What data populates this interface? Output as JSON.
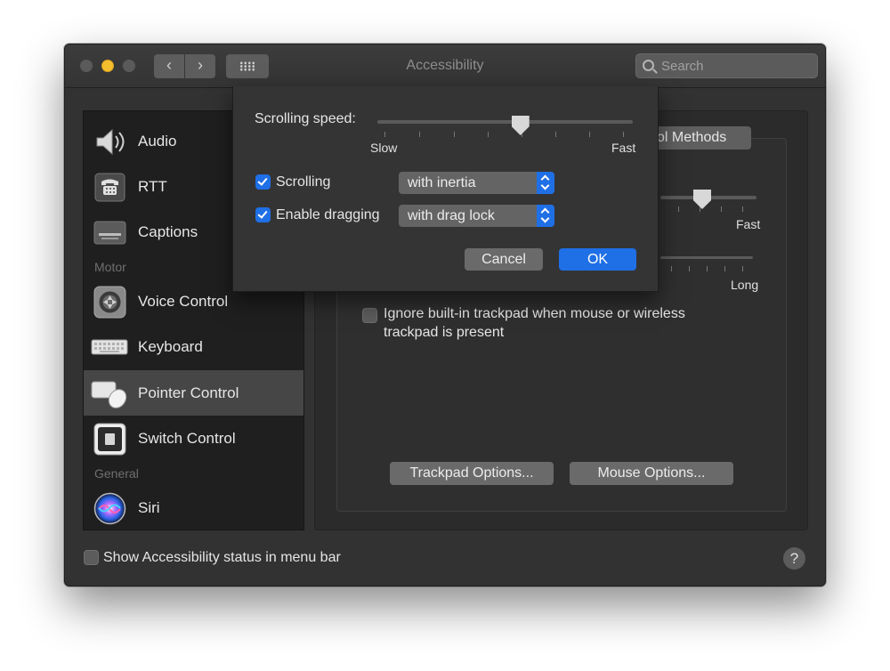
{
  "window": {
    "title": "Accessibility"
  },
  "search": {
    "placeholder": "Search"
  },
  "sidebar": {
    "items": [
      {
        "label": "Audio",
        "icon": "speaker-icon"
      },
      {
        "label": "RTT",
        "icon": "telephone-icon"
      },
      {
        "label": "Captions",
        "icon": "captions-icon"
      },
      {
        "label": "Voice Control",
        "icon": "voice-control-icon"
      },
      {
        "label": "Keyboard",
        "icon": "keyboard-icon"
      },
      {
        "label": "Pointer Control",
        "icon": "pointer-control-icon",
        "selected": true
      },
      {
        "label": "Switch Control",
        "icon": "switch-control-icon"
      },
      {
        "label": "Siri",
        "icon": "siri-icon"
      }
    ],
    "headers": {
      "motor": "Motor",
      "general": "General"
    }
  },
  "pane": {
    "tab_label": "ol Methods",
    "slider_fast": "Fast",
    "slider_long": "Long",
    "ignore_trackpad": {
      "line1": "Ignore built-in trackpad when mouse or wireless",
      "line2": "trackpad is present",
      "checked": false
    },
    "trackpad_options_label": "Trackpad Options...",
    "mouse_options_label": "Mouse Options..."
  },
  "footer": {
    "show_status_label": "Show Accessibility status in menu bar",
    "show_status_checked": false,
    "help_label": "?"
  },
  "sheet": {
    "scrolling_speed_label": "Scrolling speed:",
    "slow_label": "Slow",
    "fast_label": "Fast",
    "scrolling_speed_value": 0.56,
    "scrolling": {
      "label": "Scrolling",
      "checked": true,
      "option": "with inertia"
    },
    "dragging": {
      "label": "Enable dragging",
      "checked": true,
      "option": "with drag lock"
    },
    "cancel_label": "Cancel",
    "ok_label": "OK"
  },
  "colors": {
    "accent": "#1f6fe6",
    "window_bg": "#323233",
    "sidebar_bg": "#1f1f20",
    "minimize": "#f5be2e"
  }
}
